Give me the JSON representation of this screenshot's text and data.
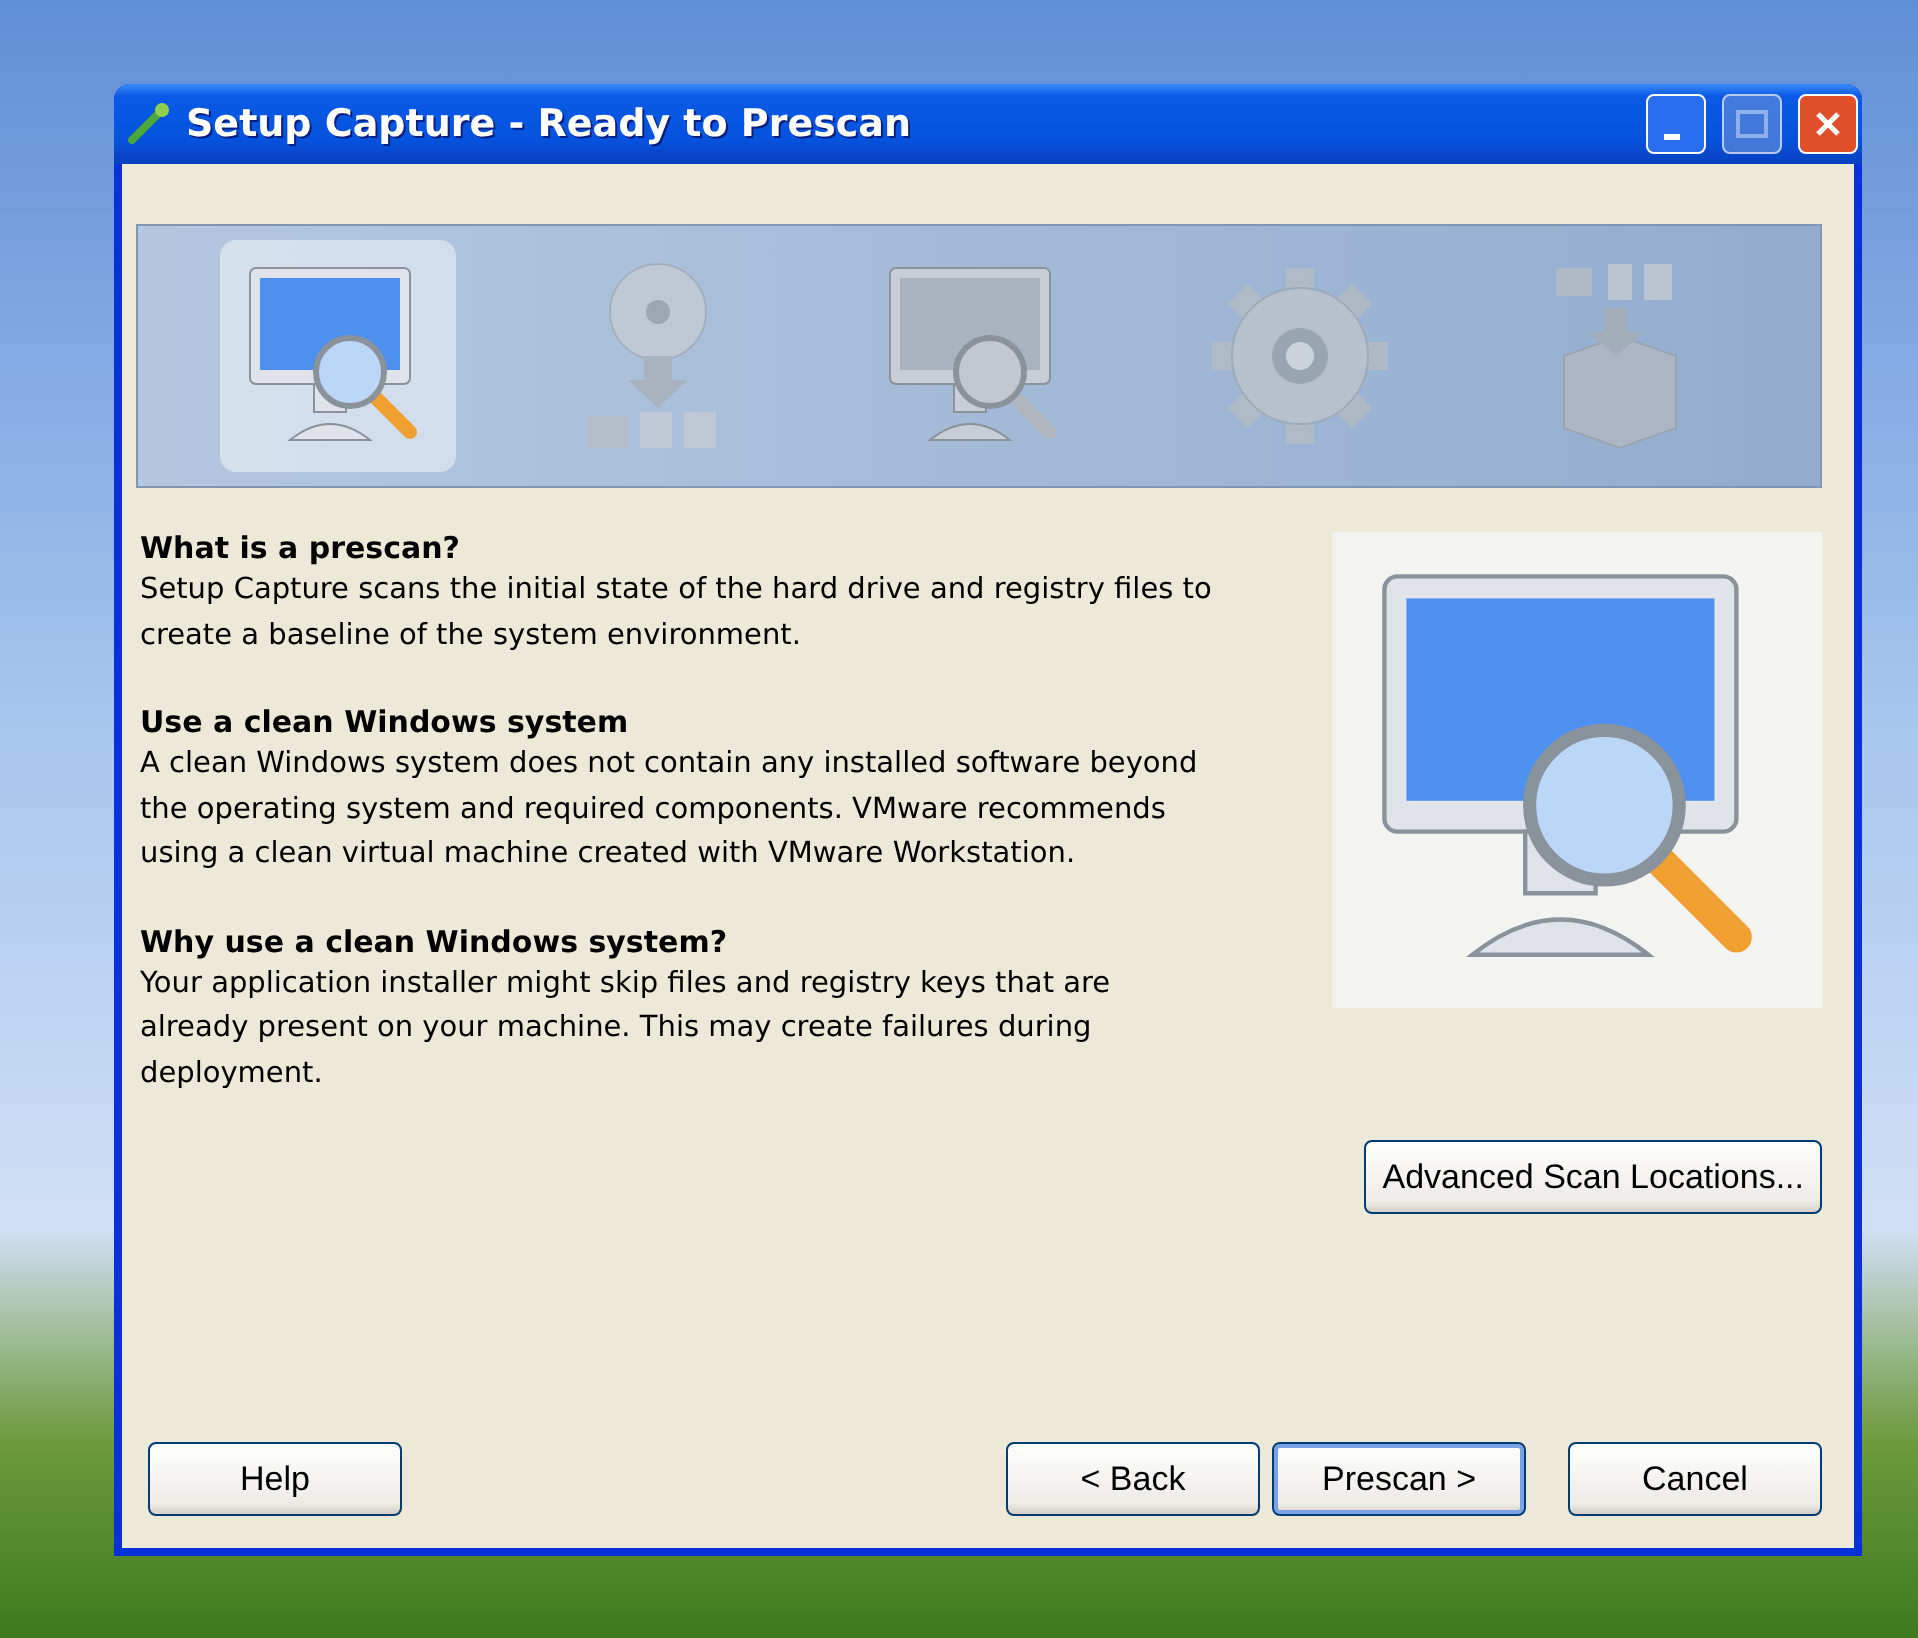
{
  "window": {
    "title": "Setup Capture - Ready to Prescan"
  },
  "steps": [
    {
      "kind": "scan",
      "selected": true
    },
    {
      "kind": "install",
      "selected": false
    },
    {
      "kind": "scan",
      "selected": false
    },
    {
      "kind": "configure",
      "selected": false
    },
    {
      "kind": "package",
      "selected": false
    }
  ],
  "sections": [
    {
      "heading": "What is a prescan?",
      "body": "Setup Capture scans the initial state of the hard drive and registry files to create a baseline of the system environment."
    },
    {
      "heading": "Use a clean Windows system",
      "body": "A clean Windows system does not contain any installed software beyond the operating system and required components. VMware recommends using a clean virtual machine created with VMware Workstation."
    },
    {
      "heading": "Why use a clean Windows system?",
      "body": "Your application installer might skip files and registry keys that are already present on your machine. This may create failures during deployment."
    }
  ],
  "advanced_button": "Advanced Scan Locations...",
  "buttons": [
    {
      "label": "Help",
      "default": false
    },
    {
      "label": "< Back",
      "default": false
    },
    {
      "label": "Prescan >",
      "default": true
    },
    {
      "label": "Cancel",
      "default": false
    }
  ]
}
